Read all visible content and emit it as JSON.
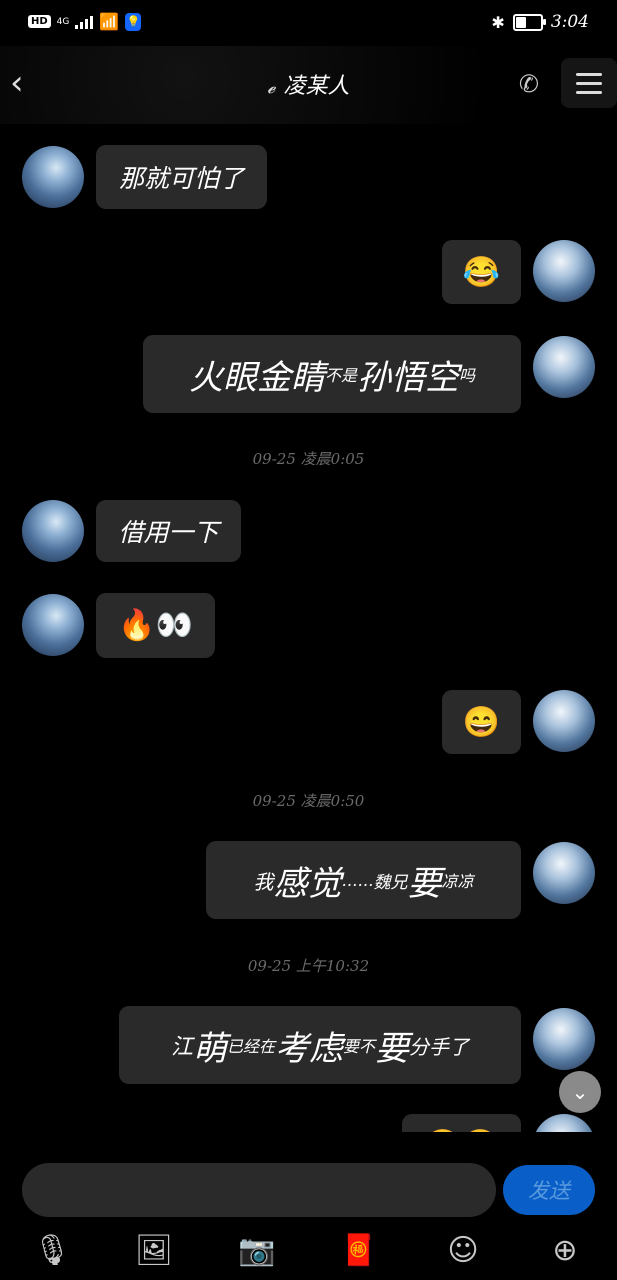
{
  "status": {
    "hd": "HD",
    "network": "4G",
    "time": "3:04",
    "battery_level": 0.4
  },
  "header": {
    "title": "凌某人",
    "icons": [
      "back-icon",
      "ear-icon",
      "phone-icon",
      "menu-icon"
    ]
  },
  "messages": {
    "m1": "那就可怕了",
    "m2_emoji": "😂",
    "m3": {
      "a": "火眼金睛",
      "b": "不是",
      "c": "孙悟空",
      "d": "吗"
    },
    "ts1": "09-25 凌晨0:05",
    "m4": "借用一下",
    "m5_emoji": "🔥👀",
    "m6_emoji": "😄",
    "ts2": "09-25 凌晨0:50",
    "m7": {
      "a": "我",
      "b": "感觉",
      "c": "……",
      "d": "魏兄",
      "e": "要",
      "f": "凉凉"
    },
    "ts3": "09-25 上午10:32",
    "m8": {
      "a": "江",
      "b": "萌",
      "c": "已经在",
      "d": "考虑",
      "e": "要不",
      "f": "要",
      "g": "分手了"
    },
    "m9_emoji": "😂😂"
  },
  "input": {
    "value": "",
    "placeholder": "",
    "send_label": "发送"
  },
  "toolbar": {
    "icons": [
      "microphone-icon",
      "image-icon",
      "camera-icon",
      "red-packet-icon",
      "emoji-icon",
      "plus-icon"
    ]
  },
  "colors": {
    "background": "#000000",
    "bubble": "#2a2a2a",
    "send_button": "#0a5ec7",
    "timestamp": "#6b6b6b"
  }
}
